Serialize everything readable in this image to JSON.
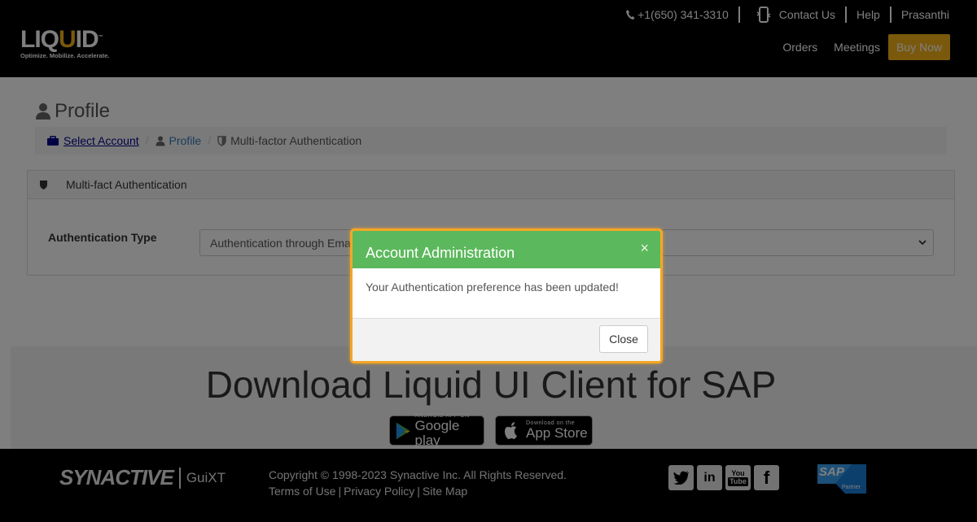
{
  "header": {
    "logo_word_pre": "LIQ",
    "logo_word_u": "U",
    "logo_word_post": "ID",
    "logo_tm": "™",
    "logo_tagline": "Optimize. Mobilize. Accelerate.",
    "phone": "+1(650) 341-3310",
    "contact_label": "Contact Us",
    "help_label": "Help",
    "user_name": "Prasanthi",
    "nav": {
      "orders": "Orders",
      "meetings": "Meetings",
      "buy_now": "Buy Now"
    },
    "accent_color": "#f5b21b"
  },
  "main": {
    "page_title": "Profile",
    "breadcrumb": {
      "select_account": "Select Account",
      "profile": "Profile",
      "current": "Multi-factor Authentication"
    },
    "panel": {
      "title": "Multi-fact Authentication",
      "form_label": "Authentication Type",
      "select_value": "Authentication through Email"
    },
    "download": {
      "title": "Download Liquid UI Client for SAP",
      "google_small": "ANDROID APP ON",
      "google_big": "Google play",
      "apple_small": "Download on the",
      "apple_big": "App Store"
    }
  },
  "footer": {
    "brand": "SYNACTIVE",
    "brand_sub": "GuiXT",
    "copyright": "Copyright © 1998-2023 Synactive Inc. All Rights Reserved.",
    "links": {
      "terms": "Terms of Use",
      "privacy": "Privacy Policy",
      "sitemap": "Site Map"
    },
    "social": {
      "linkedin": "in",
      "youtube_top": "You",
      "youtube_bottom": "Tube",
      "facebook": "f"
    },
    "sap_text": "SAP",
    "sap_partner": "Partner"
  },
  "modal": {
    "title": "Account Administration",
    "close_x": "×",
    "message": "Your Authentication preference has been updated!",
    "close_button": "Close",
    "header_color": "#5cb85c",
    "border_color": "#f5a623"
  }
}
